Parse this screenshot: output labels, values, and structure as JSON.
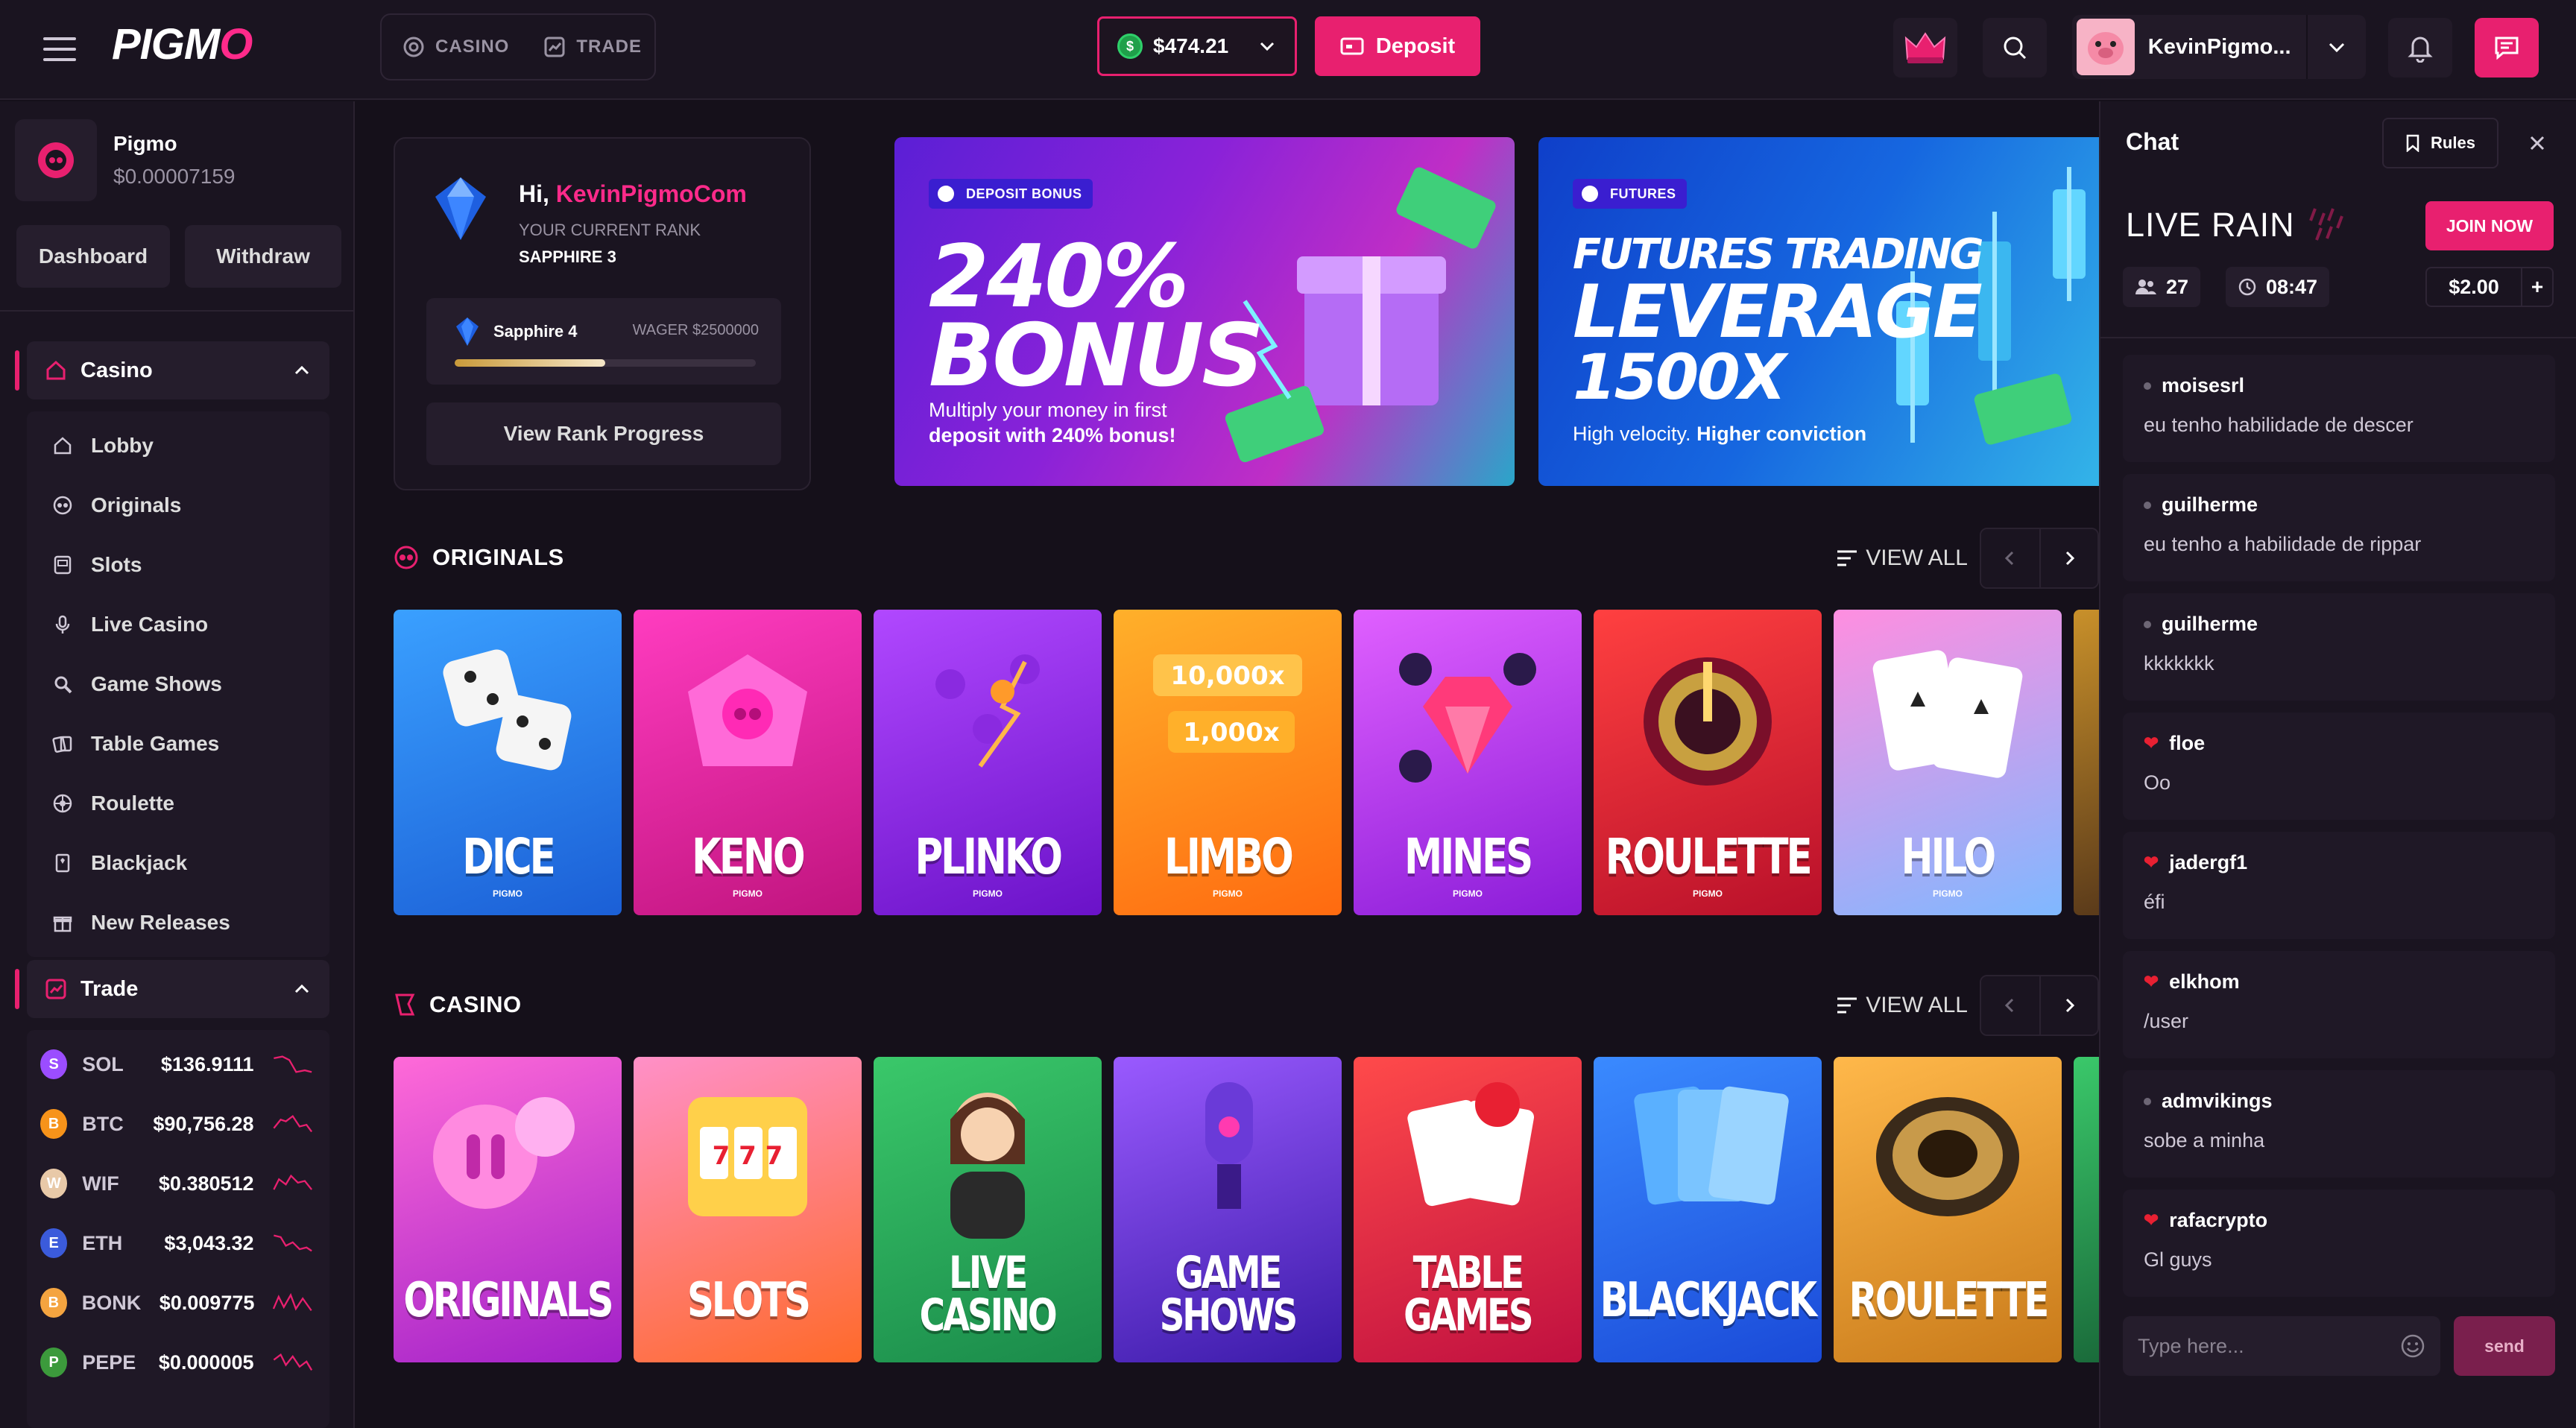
{
  "header": {
    "logo": "PIGMO",
    "nav": [
      {
        "label": "CASINO",
        "icon": "casino-chip-icon"
      },
      {
        "label": "TRADE",
        "icon": "trade-chart-icon"
      }
    ],
    "balance": "$474.21",
    "deposit_label": "Deposit",
    "username": "KevinPigmo...",
    "accent": "#e8206f"
  },
  "sidebar": {
    "wallet_name": "Pigmo",
    "wallet_balance": "$0.00007159",
    "dashboard_label": "Dashboard",
    "withdraw_label": "Withdraw",
    "casino_section": "Casino",
    "casino_items": [
      {
        "label": "Lobby",
        "icon": "home-icon"
      },
      {
        "label": "Originals",
        "icon": "pigmo-originals-icon"
      },
      {
        "label": "Slots",
        "icon": "slot-machine-icon"
      },
      {
        "label": "Live Casino",
        "icon": "microphone-icon"
      },
      {
        "label": "Game Shows",
        "icon": "magnifier-icon"
      },
      {
        "label": "Table Games",
        "icon": "cards-icon"
      },
      {
        "label": "Roulette",
        "icon": "roulette-icon"
      },
      {
        "label": "Blackjack",
        "icon": "blackjack-icon"
      },
      {
        "label": "New Releases",
        "icon": "gift-icon"
      }
    ],
    "trade_section": "Trade",
    "tickers": [
      {
        "symbol": "SOL",
        "price": "$136.9111",
        "color": "#9b4dff"
      },
      {
        "symbol": "BTC",
        "price": "$90,756.28",
        "color": "#f7931a"
      },
      {
        "symbol": "WIF",
        "price": "$0.380512",
        "color": "#e8c9a8"
      },
      {
        "symbol": "ETH",
        "price": "$3,043.32",
        "color": "#3b5bdb"
      },
      {
        "symbol": "BONK",
        "price": "$0.009775",
        "color": "#f4a440"
      },
      {
        "symbol": "PEPE",
        "price": "$0.000005",
        "color": "#3c9a3c"
      }
    ]
  },
  "rank": {
    "greeting": "Hi,",
    "user": "KevinPigmoCom",
    "current_rank_label": "YOUR CURRENT RANK",
    "current_rank": "SAPPHIRE 3",
    "next_rank": "Sapphire 4",
    "wager": "WAGER $2500000",
    "progress": 0.5,
    "view_progress_label": "View Rank Progress"
  },
  "banners": [
    {
      "tag": "DEPOSIT BONUS",
      "title_1": "240%",
      "title_2": "BONUS",
      "sub_1": "Multiply your money in first",
      "sub_2": "deposit with 240% bonus!"
    },
    {
      "tag": "FUTURES",
      "title_1": "FUTURES TRADING",
      "title_2": "LEVERAGE",
      "title_3": "1500X",
      "sub_a": "High velocity.",
      "sub_b": "Higher conviction"
    }
  ],
  "originals": {
    "title": "ORIGINALS",
    "view_all": "VIEW ALL",
    "games": [
      {
        "name": "DICE",
        "brand": "PIGMO"
      },
      {
        "name": "KENO",
        "brand": "PIGMO"
      },
      {
        "name": "PLINKO",
        "brand": "PIGMO"
      },
      {
        "name": "LIMBO",
        "brand": "PIGMO"
      },
      {
        "name": "MINES",
        "brand": "PIGMO"
      },
      {
        "name": "ROULETTE",
        "brand": "PIGMO"
      },
      {
        "name": "HILO",
        "brand": "PIGMO"
      }
    ]
  },
  "casino": {
    "title": "CASINO",
    "view_all": "VIEW ALL",
    "games": [
      {
        "name_1": "ORIGINALS",
        "name_2": ""
      },
      {
        "name_1": "SLOTS",
        "name_2": ""
      },
      {
        "name_1": "LIVE",
        "name_2": "CASINO"
      },
      {
        "name_1": "GAME",
        "name_2": "SHOWS"
      },
      {
        "name_1": "TABLE",
        "name_2": "GAMES"
      },
      {
        "name_1": "BLACKJACK",
        "name_2": ""
      },
      {
        "name_1": "ROULETTE",
        "name_2": ""
      }
    ]
  },
  "chat": {
    "title": "Chat",
    "rules_label": "Rules",
    "rain_title": "LIVE RAIN",
    "join_label": "JOIN NOW",
    "participants": "27",
    "timer": "08:47",
    "amount": "$2.00",
    "plus": "+",
    "messages": [
      {
        "user": "moisesrl",
        "text": "eu tenho habilidade de descer",
        "badge": "dot"
      },
      {
        "user": "guilherme",
        "text": "eu tenho a habilidade de rippar",
        "badge": "dot"
      },
      {
        "user": "guilherme",
        "text": "kkkkkkk",
        "badge": "dot"
      },
      {
        "user": "floe",
        "text": "Oo",
        "badge": "heart"
      },
      {
        "user": "jadergf1",
        "text": "éfi",
        "badge": "heart"
      },
      {
        "user": "elkhom",
        "text": "/user",
        "badge": "heart"
      },
      {
        "user": "admvikings",
        "text": "sobe a minha",
        "badge": "dot"
      },
      {
        "user": "rafacrypto",
        "text": "Gl guys",
        "badge": "heart"
      }
    ],
    "input_placeholder": "Type here...",
    "send_label": "send"
  }
}
